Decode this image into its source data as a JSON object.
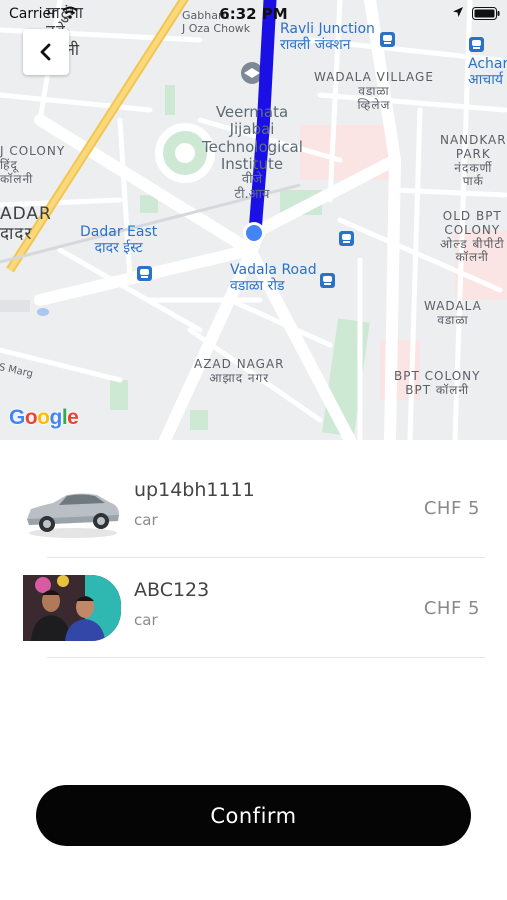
{
  "status_bar": {
    "carrier": "Carrier",
    "time": "6:32 PM"
  },
  "map": {
    "labels": {
      "gabharu": "Gabharu",
      "oza_chowk": "J Oza Chowk",
      "ravli_en": "Ravli Junction",
      "ravli_hi": "रावली जंक्शन",
      "wadala_village_en": "WADALA VILLAGE",
      "wadala_village_hi1": "वडाळा",
      "wadala_village_hi2": "व्हिलेज",
      "achar_en": "Achar",
      "achar_hi": "आचार्य",
      "vjti_1": "Veermata",
      "vjti_2": "Jijabai",
      "vjti_3": "Technological",
      "vjti_4": "Institute",
      "vjti_hi1": "वीजे",
      "vjti_hi2": "टी.आय",
      "nandkar_1": "NANDKAR",
      "nandkar_2": "PARK",
      "nandkar_hi1": "नंदकर्णी",
      "nandkar_hi2": "पार्क",
      "colony_en": "J COLONY",
      "colony_hi1": "हिंदू",
      "colony_hi2": "कॉलनी",
      "dadar_en": "ADAR",
      "dadar_hi": "दादर",
      "top_left_hi1": "माटुंगा",
      "top_left_hi2": "नवे",
      "top_left_hi3": "नी",
      "dadar_east_en": "Dadar East",
      "dadar_east_hi": "दादर ईस्ट",
      "old_bpt_1": "OLD BPT",
      "old_bpt_2": "COLONY",
      "old_bpt_hi1": "ओल्ड बीपीटी",
      "old_bpt_hi2": "कॉलनी",
      "vadala_road_en": "Vadala Road",
      "vadala_road_hi": "वडाळा रोड",
      "wadala_en": "WADALA",
      "wadala_hi": "वडाळा",
      "azad_en": "AZAD NAGAR",
      "azad_hi": "आझाद नगर",
      "marg": "S Marg",
      "bpt_1": "BPT COLONY",
      "bpt_2": "BPT कॉलनी"
    },
    "google_logo": [
      "G",
      "o",
      "o",
      "g",
      "l",
      "e"
    ],
    "route_color": "#1a10e6",
    "location_dot_color": "#4285f4"
  },
  "vehicles": [
    {
      "name": "up14bh1111",
      "type": "car",
      "price": "CHF 5",
      "image": "silver-car-photo"
    },
    {
      "name": "ABC123",
      "type": "car",
      "price": "CHF 5",
      "image": "people-photo"
    }
  ],
  "confirm_label": "Confirm"
}
